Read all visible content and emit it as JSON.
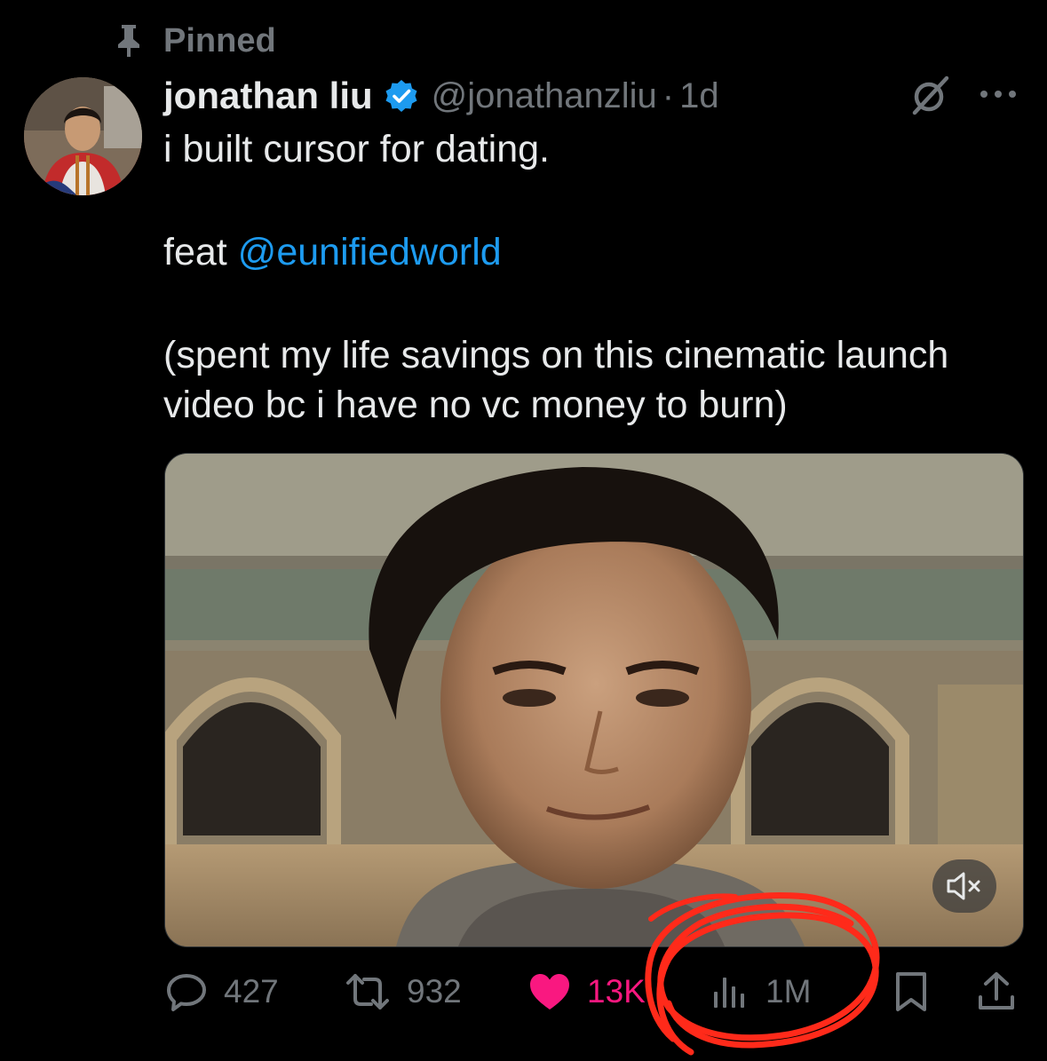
{
  "pinned": {
    "label": "Pinned"
  },
  "author": {
    "display_name": "jonathan liu",
    "handle": "@jonathanzliu",
    "separator": "·",
    "time": "1d",
    "verified": true
  },
  "tweet": {
    "line1": "i built cursor for dating.",
    "line2_prefix": "feat ",
    "mention": "@eunifiedworld",
    "line3": "(spent my life savings on this cinematic launch video bc i have no vc money to burn)"
  },
  "actions": {
    "replies": "427",
    "reposts": "932",
    "likes": "13K",
    "views": "1M"
  },
  "colors": {
    "background": "#000000",
    "text": "#e7e9ea",
    "muted": "#71767b",
    "link": "#1d9bf0",
    "like": "#f91880",
    "annotation": "#ff2a1a"
  }
}
